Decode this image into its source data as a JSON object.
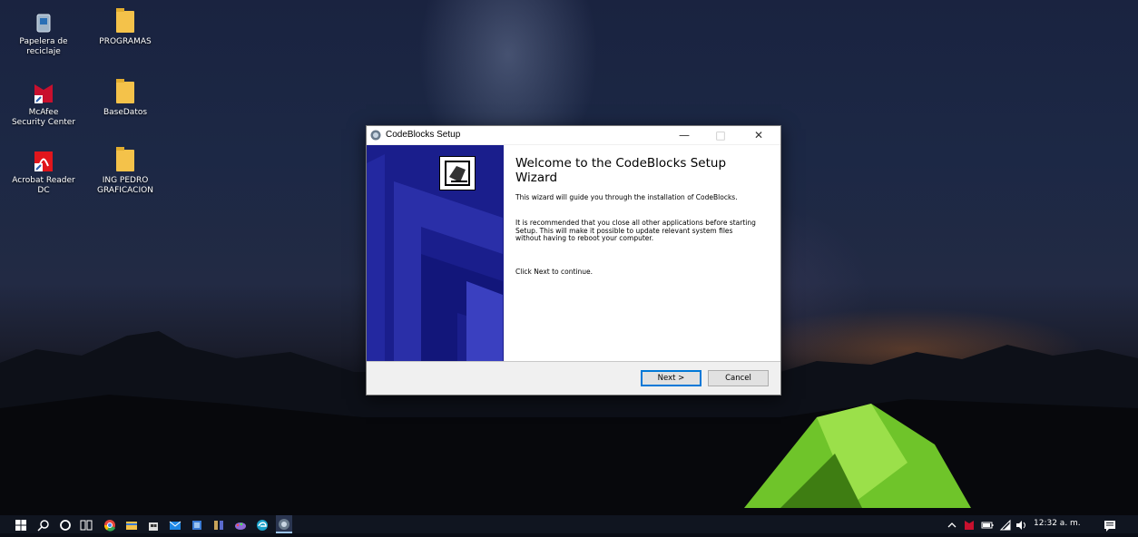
{
  "desktop_icons": [
    {
      "label": "Papelera de reciclaje",
      "icon": "recycle-bin-icon"
    },
    {
      "label": "PROGRAMAS",
      "icon": "folder-icon"
    },
    {
      "label": "McAfee Security Center",
      "icon": "mcafee-icon"
    },
    {
      "label": "BaseDatos",
      "icon": "folder-icon"
    },
    {
      "label": "Acrobat Reader DC",
      "icon": "acrobat-icon"
    },
    {
      "label": "ING PEDRO GRAFICACION",
      "icon": "folder-icon"
    }
  ],
  "dialog": {
    "title": "CodeBlocks Setup",
    "heading": "Welcome to the CodeBlocks Setup Wizard",
    "paragraphs": [
      "This wizard will guide you through the installation of CodeBlocks.",
      "It is recommended that you close all other applications before starting Setup. This will make it possible to update relevant system files without having to reboot your computer.",
      "Click Next to continue."
    ],
    "next_label": "Next >",
    "cancel_label": "Cancel",
    "side_color": "#1a1e8c"
  },
  "taskbar": {
    "pinned": [
      "windows-start-icon",
      "search-icon",
      "cortana-icon",
      "task-view-icon",
      "chrome-icon",
      "file-explorer-icon",
      "store-icon",
      "mail-icon",
      "app-icon",
      "app-icon-2",
      "paint-icon",
      "edge-icon",
      "codeblocks-installer-icon"
    ],
    "tray": {
      "time": "12:32 a. m."
    }
  }
}
